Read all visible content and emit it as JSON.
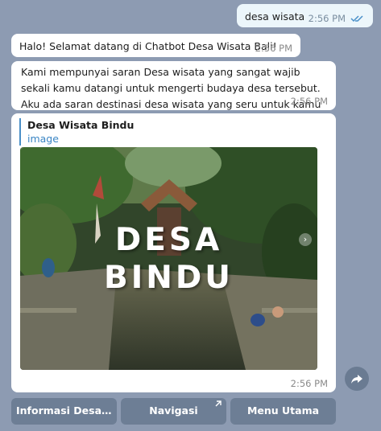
{
  "messages": [
    {
      "text": "desa wisata",
      "time": "2:56 PM",
      "outgoing": true
    },
    {
      "text": "Halo! Selamat datang di Chatbot Desa Wisata Bali!",
      "time": "2:56 PM"
    },
    {
      "text": "Kami mempunyai saran Desa wisata yang sangat wajib sekali kamu datangi untuk mengerti budaya desa tersebut. Aku ada saran destinasi desa wisata yang seru untuk kamu datangi! 😊",
      "time": "2:56 PM"
    }
  ],
  "card": {
    "site_name": "Desa Wisata Bindu",
    "preview_label": "image",
    "overlay_line1": "DESA",
    "overlay_line2": "BINDU",
    "time": "2:56 PM"
  },
  "keyboard": [
    {
      "label": "Informasi Desa Wi..."
    },
    {
      "label": "Navigasi"
    },
    {
      "label": "Menu Utama"
    }
  ],
  "icons": {
    "checks": "double-check-icon",
    "share": "share-forward-icon",
    "next": "chevron-right-icon",
    "external": "external-arrow-icon"
  },
  "colors": {
    "background": "#8d9bb2",
    "bubble": "#ffffff",
    "outgoing_bubble": "#ecf6fb",
    "link": "#3a85c4",
    "keyboard_button": "#6d7e95"
  }
}
